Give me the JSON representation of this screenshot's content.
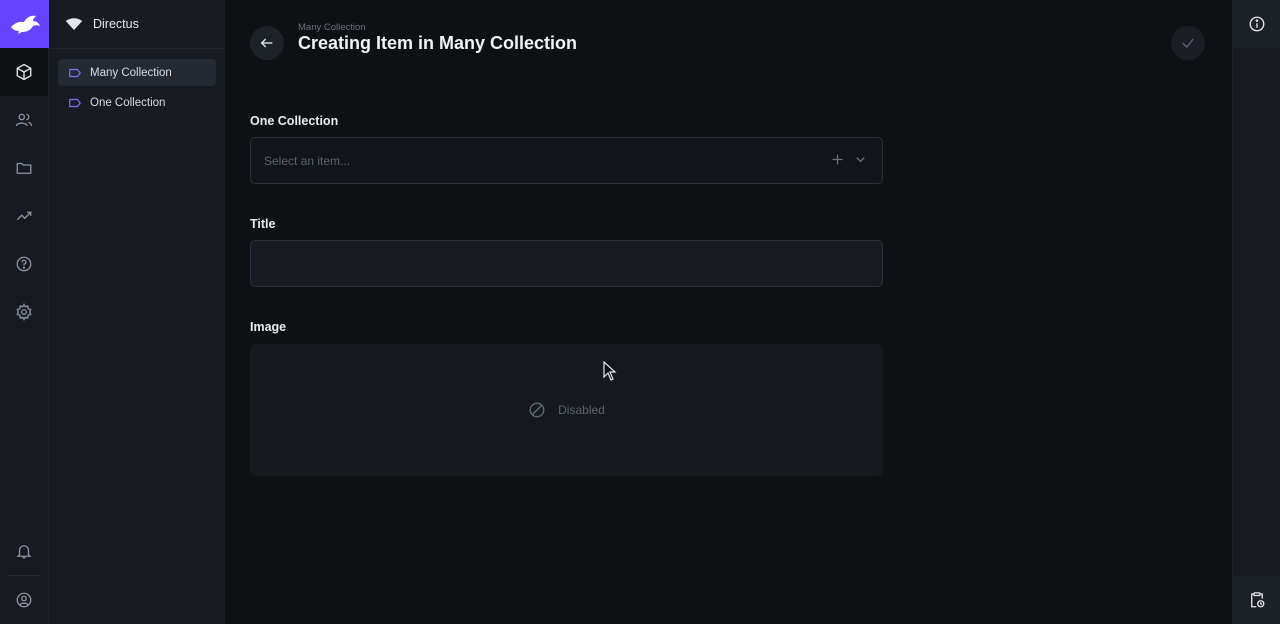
{
  "app": {
    "project_name": "Directus",
    "brand_color": "#6644ff"
  },
  "module_bar": {
    "items": [
      {
        "icon": "content-box-icon",
        "active": true
      },
      {
        "icon": "users-icon",
        "active": false
      },
      {
        "icon": "folder-icon",
        "active": false
      },
      {
        "icon": "insights-icon",
        "active": false
      },
      {
        "icon": "help-icon",
        "active": false
      },
      {
        "icon": "settings-gear-icon",
        "active": false
      }
    ],
    "bottom_items": [
      {
        "icon": "notifications-bell-icon"
      },
      {
        "icon": "user-account-icon"
      }
    ]
  },
  "navigation": {
    "items": [
      {
        "label": "Many Collection",
        "active": true,
        "icon": "collection-label-icon"
      },
      {
        "label": "One Collection",
        "active": false,
        "icon": "collection-label-icon"
      }
    ]
  },
  "header": {
    "breadcrumb": "Many Collection",
    "title": "Creating Item in Many Collection"
  },
  "form": {
    "one_collection": {
      "label": "One Collection",
      "placeholder": "Select an item..."
    },
    "title": {
      "label": "Title",
      "value": ""
    },
    "image": {
      "label": "Image",
      "state_text": "Disabled"
    }
  }
}
